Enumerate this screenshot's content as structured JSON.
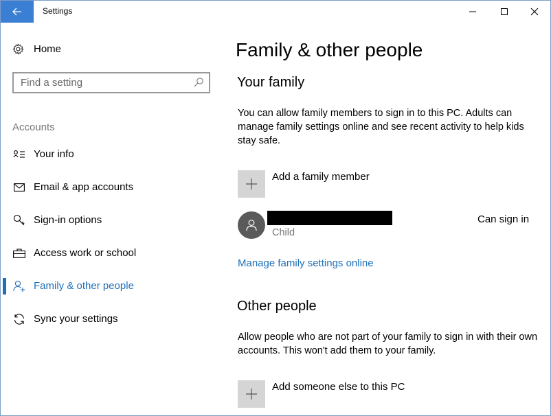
{
  "window": {
    "title": "Settings",
    "accent": "#3b7fd4"
  },
  "sidebar": {
    "home_label": "Home",
    "search_placeholder": "Find a setting",
    "section_label": "Accounts",
    "items": [
      {
        "label": "Your info",
        "icon": "contact-card-icon"
      },
      {
        "label": "Email & app accounts",
        "icon": "mail-icon"
      },
      {
        "label": "Sign-in options",
        "icon": "key-icon"
      },
      {
        "label": "Access work or school",
        "icon": "briefcase-icon"
      },
      {
        "label": "Family & other people",
        "icon": "person-add-icon",
        "active": true
      },
      {
        "label": "Sync your settings",
        "icon": "sync-icon"
      }
    ]
  },
  "main": {
    "title": "Family & other people",
    "family": {
      "heading": "Your family",
      "description": "You can allow family members to sign in to this PC. Adults can manage family settings online and see recent activity to help kids stay safe.",
      "add_label": "Add a family member",
      "member": {
        "role": "Child",
        "status": "Can sign in"
      },
      "manage_link": "Manage family settings online"
    },
    "other": {
      "heading": "Other people",
      "description": "Allow people who are not part of your family to sign in with their own accounts. This won't add them to your family.",
      "add_label": "Add someone else to this PC"
    }
  },
  "colors": {
    "link": "#1e6fb8",
    "active_indicator": "#1e6fb8",
    "add_tile": "#d5d5d5",
    "avatar": "#5a5a5a"
  }
}
